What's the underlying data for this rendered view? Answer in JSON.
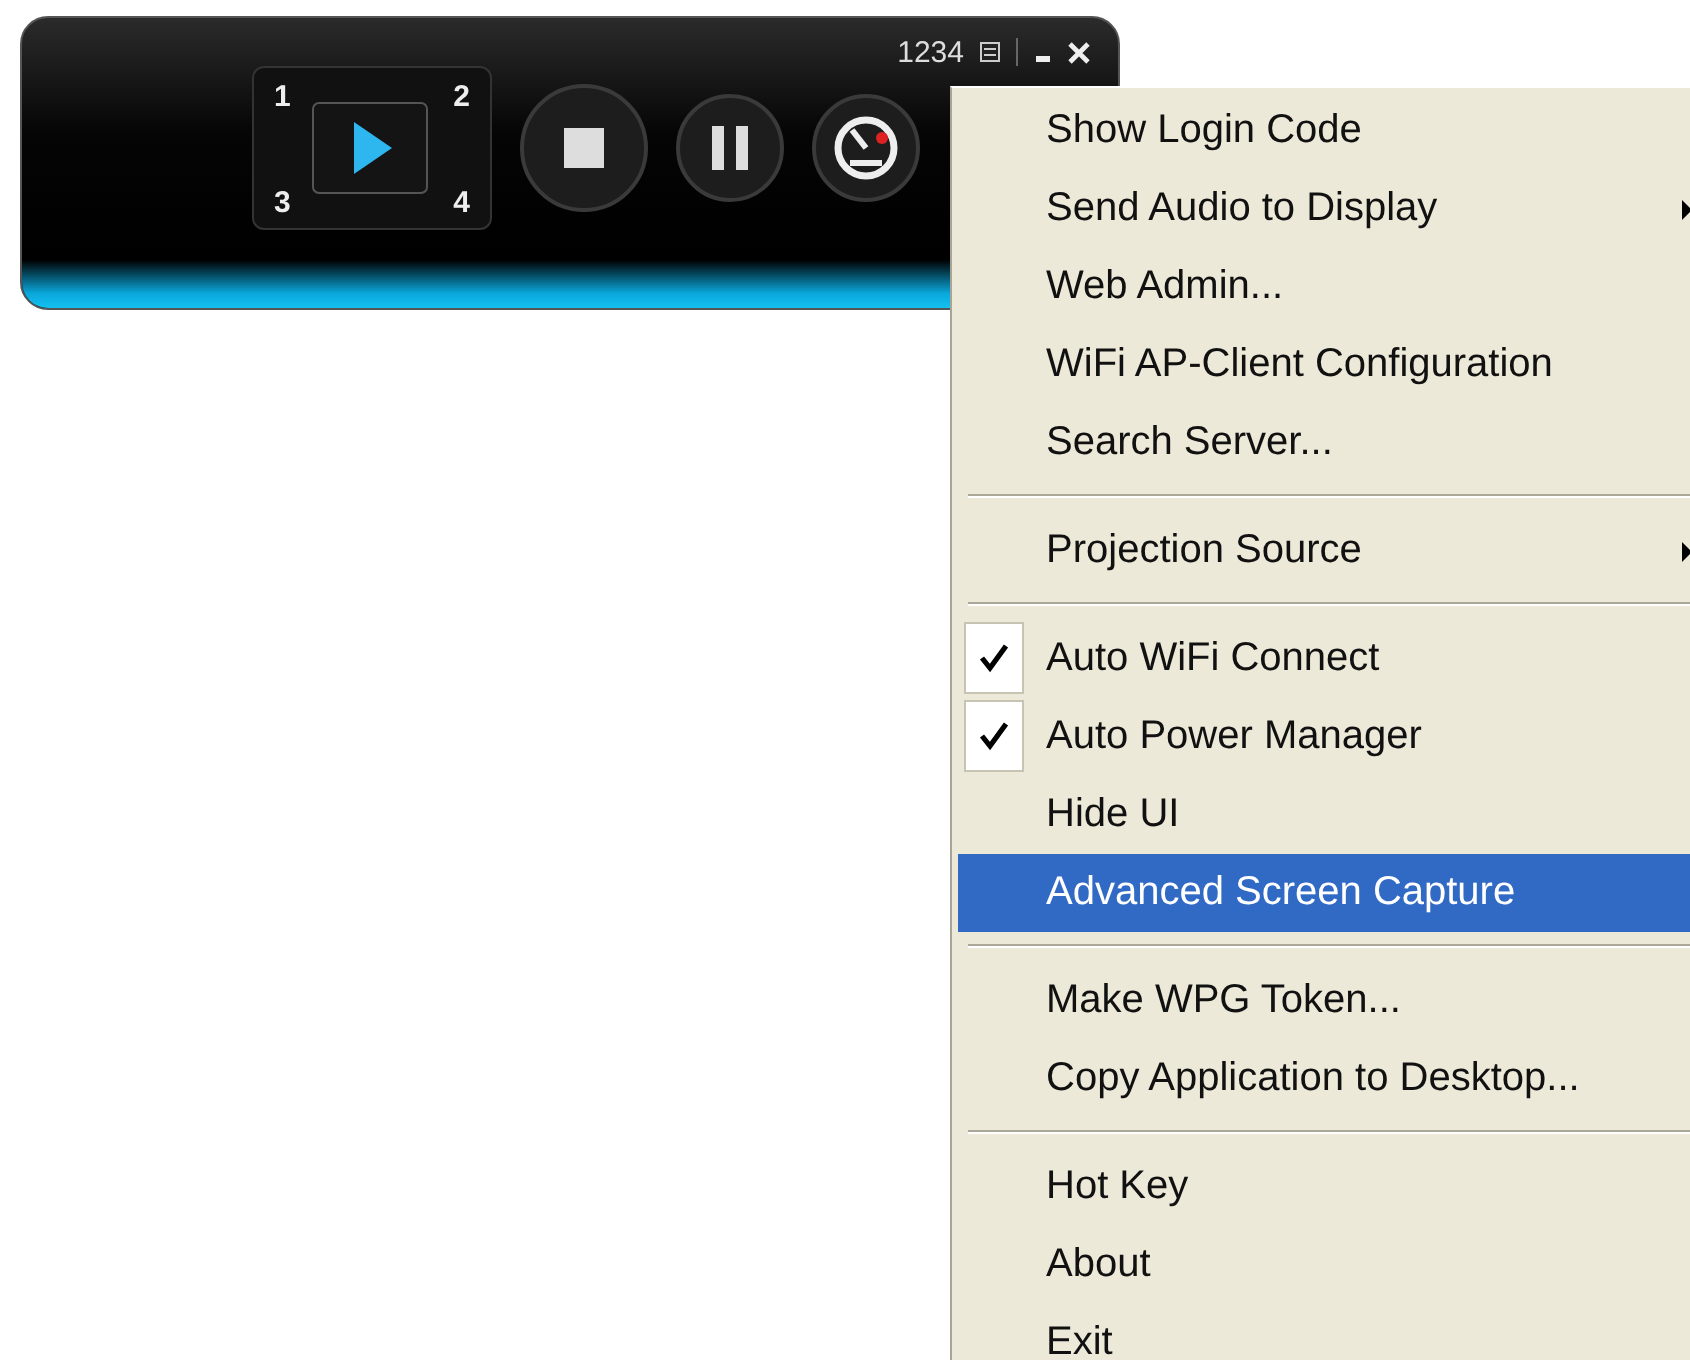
{
  "player": {
    "code": "1234",
    "quadrants": [
      "1",
      "2",
      "3",
      "4"
    ]
  },
  "menu": [
    {
      "kind": "item",
      "label": "Show Login Code",
      "checked": false,
      "submenu": false,
      "selected": false
    },
    {
      "kind": "item",
      "label": "Send Audio to Display",
      "checked": false,
      "submenu": true,
      "selected": false
    },
    {
      "kind": "item",
      "label": "Web Admin...",
      "checked": false,
      "submenu": false,
      "selected": false
    },
    {
      "kind": "item",
      "label": "WiFi AP-Client Configuration",
      "checked": false,
      "submenu": false,
      "selected": false
    },
    {
      "kind": "item",
      "label": "Search Server...",
      "checked": false,
      "submenu": false,
      "selected": false
    },
    {
      "kind": "separator"
    },
    {
      "kind": "item",
      "label": "Projection Source",
      "checked": false,
      "submenu": true,
      "selected": false
    },
    {
      "kind": "separator"
    },
    {
      "kind": "item",
      "label": "Auto WiFi Connect",
      "checked": true,
      "submenu": false,
      "selected": false
    },
    {
      "kind": "item",
      "label": "Auto Power Manager",
      "checked": true,
      "submenu": false,
      "selected": false
    },
    {
      "kind": "item",
      "label": "Hide UI",
      "checked": false,
      "submenu": false,
      "selected": false
    },
    {
      "kind": "item",
      "label": "Advanced Screen Capture",
      "checked": false,
      "submenu": false,
      "selected": true
    },
    {
      "kind": "separator"
    },
    {
      "kind": "item",
      "label": "Make WPG Token...",
      "checked": false,
      "submenu": false,
      "selected": false
    },
    {
      "kind": "item",
      "label": "Copy Application to Desktop...",
      "checked": false,
      "submenu": false,
      "selected": false
    },
    {
      "kind": "separator"
    },
    {
      "kind": "item",
      "label": "Hot Key",
      "checked": false,
      "submenu": false,
      "selected": false
    },
    {
      "kind": "item",
      "label": "About",
      "checked": false,
      "submenu": false,
      "selected": false
    },
    {
      "kind": "item",
      "label": "Exit",
      "checked": false,
      "submenu": false,
      "selected": false
    }
  ]
}
